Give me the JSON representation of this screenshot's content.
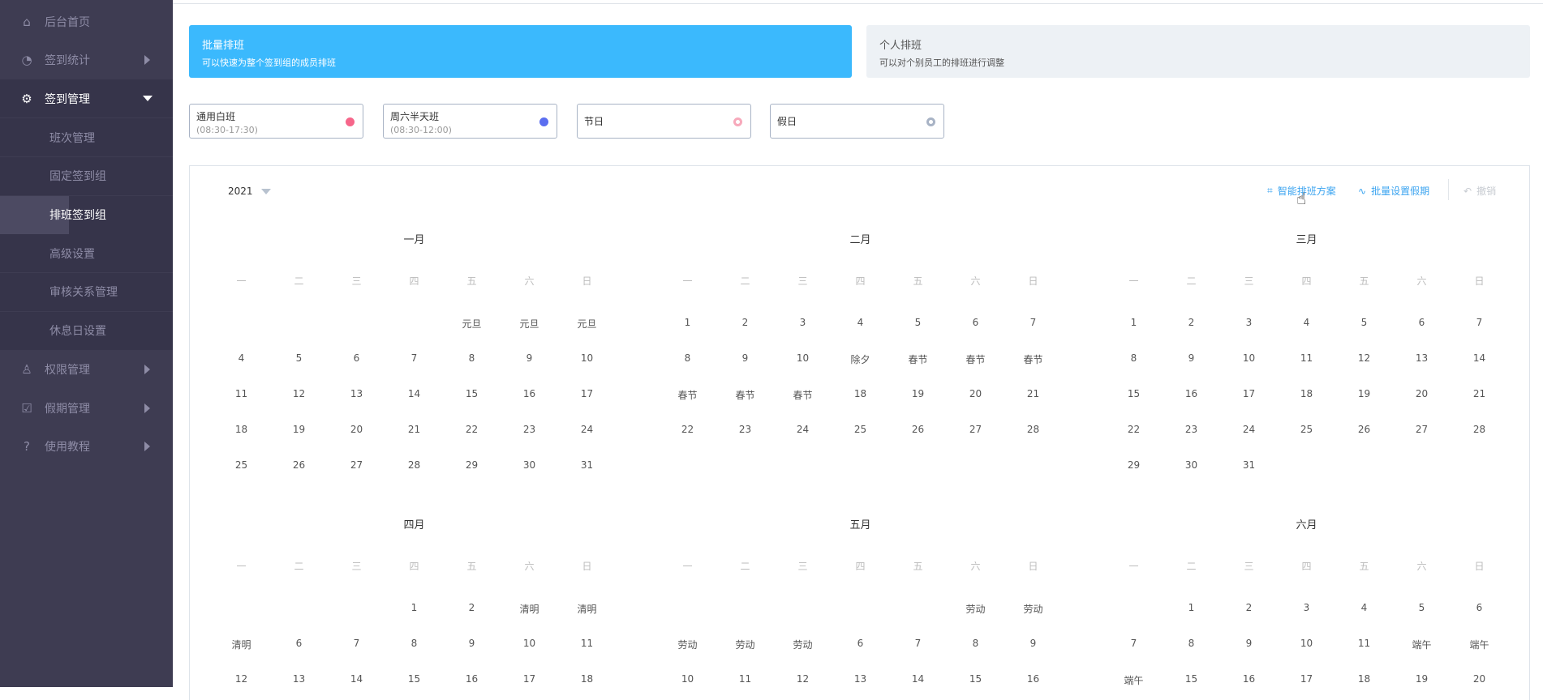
{
  "sidebar": {
    "items": [
      {
        "label": "后台首页",
        "icon": "home-icon",
        "glyph": "⌂",
        "arrow": false
      },
      {
        "label": "签到统计",
        "icon": "pie-chart-icon",
        "glyph": "◔",
        "arrow": true
      },
      {
        "label": "签到管理",
        "icon": "gear-icon",
        "glyph": "⚙",
        "arrow": true,
        "open": true,
        "children": [
          {
            "label": "班次管理"
          },
          {
            "label": "固定签到组"
          },
          {
            "label": "排班签到组",
            "active": true
          },
          {
            "label": "高级设置"
          },
          {
            "label": "审核关系管理"
          },
          {
            "label": "休息日设置"
          }
        ]
      },
      {
        "label": "权限管理",
        "icon": "user-icon",
        "glyph": "♙",
        "arrow": true
      },
      {
        "label": "假期管理",
        "icon": "calendar-check-icon",
        "glyph": "☑",
        "arrow": true
      },
      {
        "label": "使用教程",
        "icon": "help-icon",
        "glyph": "?",
        "arrow": true
      }
    ]
  },
  "modes": [
    {
      "title": "批量排班",
      "desc": "可以快速为整个签到组的成员排班"
    },
    {
      "title": "个人排班",
      "desc": "可以对个别员工的排班进行调整"
    }
  ],
  "legend": [
    {
      "name": "通用白班",
      "time": "(08:30-17:30)",
      "color": "#f6668a"
    },
    {
      "name": "周六半天班",
      "time": "(08:30-12:00)",
      "color": "#5b6ef0"
    },
    {
      "name": "节日",
      "color": "#f7a9bb"
    },
    {
      "name": "假日",
      "color": "#a8b3c5"
    }
  ],
  "calendar": {
    "year": "2021",
    "actions": {
      "smart": "智能排班方案",
      "holidays": "批量设置假期",
      "undo": "撤销"
    },
    "weekdays": [
      "一",
      "二",
      "三",
      "四",
      "五",
      "六",
      "日"
    ],
    "months": [
      {
        "title": "一月",
        "offset": 4,
        "days": [
          "元旦",
          "元旦",
          "元旦",
          "4",
          "5",
          "6",
          "7",
          "8",
          "9",
          "10",
          "11",
          "12",
          "13",
          "14",
          "15",
          "16",
          "17",
          "18",
          "19",
          "20",
          "21",
          "22",
          "23",
          "24",
          "25",
          "26",
          "27",
          "28",
          "29",
          "30",
          "31"
        ]
      },
      {
        "title": "二月",
        "offset": 0,
        "days": [
          "1",
          "2",
          "3",
          "4",
          "5",
          "6",
          "7",
          "8",
          "9",
          "10",
          "除夕",
          "春节",
          "春节",
          "春节",
          "春节",
          "春节",
          "春节",
          "18",
          "19",
          "20",
          "21",
          "22",
          "23",
          "24",
          "25",
          "26",
          "27",
          "28"
        ]
      },
      {
        "title": "三月",
        "offset": 0,
        "days": [
          "1",
          "2",
          "3",
          "4",
          "5",
          "6",
          "7",
          "8",
          "9",
          "10",
          "11",
          "12",
          "13",
          "14",
          "15",
          "16",
          "17",
          "18",
          "19",
          "20",
          "21",
          "22",
          "23",
          "24",
          "25",
          "26",
          "27",
          "28",
          "29",
          "30",
          "31"
        ]
      },
      {
        "title": "四月",
        "offset": 3,
        "days": [
          "1",
          "2",
          "清明",
          "清明",
          "清明",
          "6",
          "7",
          "8",
          "9",
          "10",
          "11",
          "12",
          "13",
          "14",
          "15",
          "16",
          "17",
          "18"
        ]
      },
      {
        "title": "五月",
        "offset": 5,
        "days": [
          "劳动",
          "劳动",
          "劳动",
          "劳动",
          "劳动",
          "6",
          "7",
          "8",
          "9",
          "10",
          "11",
          "12",
          "13",
          "14",
          "15",
          "16"
        ]
      },
      {
        "title": "六月",
        "offset": 1,
        "days": [
          "1",
          "2",
          "3",
          "4",
          "5",
          "6",
          "7",
          "8",
          "9",
          "10",
          "11",
          "端午",
          "端午",
          "端午",
          "15",
          "16",
          "17",
          "18",
          "19",
          "20"
        ]
      }
    ]
  }
}
